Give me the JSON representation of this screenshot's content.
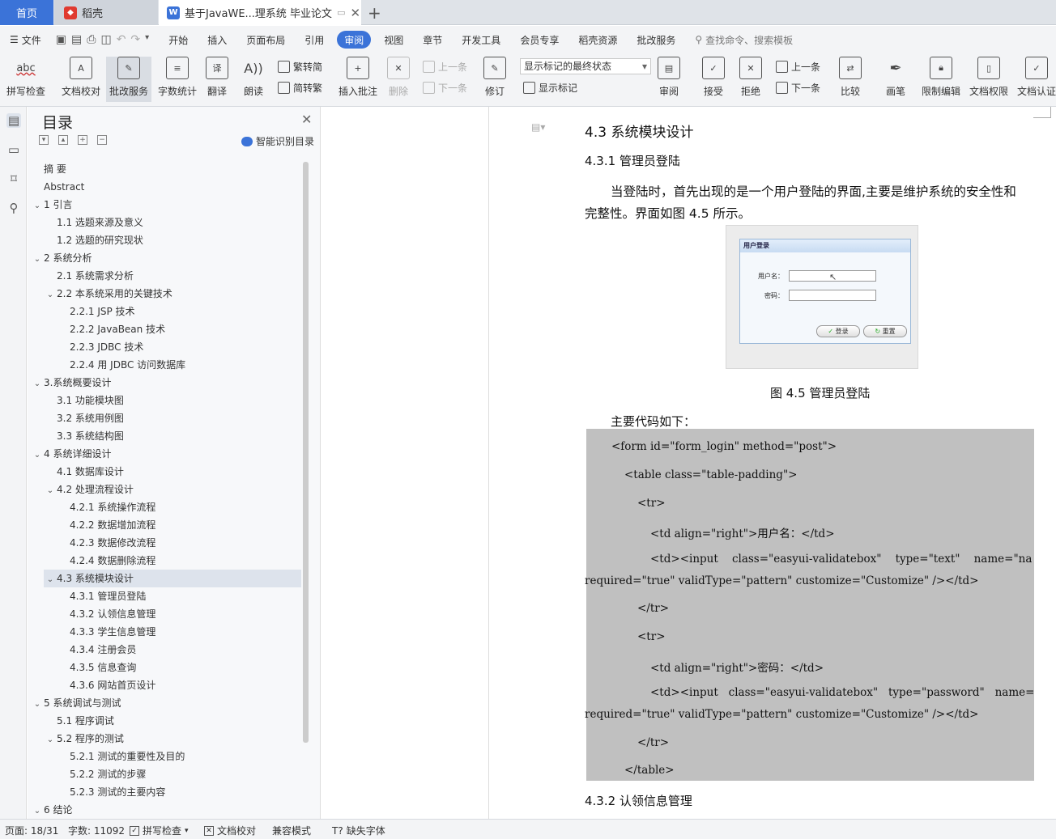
{
  "tabs": {
    "home": "首页",
    "daoke": "稻壳",
    "doc": "基于JavaWE...理系统 毕业论文"
  },
  "menu": {
    "file": "文件",
    "items": [
      "开始",
      "插入",
      "页面布局",
      "引用",
      "审阅",
      "视图",
      "章节",
      "开发工具",
      "会员专享",
      "稻壳资源",
      "批改服务"
    ],
    "search": "查找命令、搜索模板"
  },
  "ribbon": {
    "abc": "abc",
    "spell": "拼写检查",
    "proofread": "文档校对",
    "grading": "批改服务",
    "wordcount": "字数统计",
    "translate": "翻译",
    "read": "朗读",
    "trad": "繁转简",
    "simp": "简转繁",
    "insert_comment": "插入批注",
    "delete": "删除",
    "prev": "上一条",
    "next": "下一条",
    "revise": "修订",
    "mark_state": "显示标记的最终状态",
    "show_marks": "显示标记",
    "review": "审阅",
    "accept": "接受",
    "reject": "拒绝",
    "prev2": "上一条",
    "next2": "下一条",
    "compare": "比较",
    "pen": "画笔",
    "restrict": "限制编辑",
    "rights": "文档权限",
    "certify": "文档认证"
  },
  "toc": {
    "title": "目录",
    "smart": "智能识别目录",
    "items": [
      {
        "t": "摘  要",
        "lvl": 0
      },
      {
        "t": "Abstract",
        "lvl": 0
      },
      {
        "t": "1  引言",
        "lvl": 0,
        "c": true
      },
      {
        "t": "1.1  选题来源及意义",
        "lvl": 1
      },
      {
        "t": "1.2  选题的研究现状",
        "lvl": 1
      },
      {
        "t": "2  系统分析",
        "lvl": 0,
        "c": true
      },
      {
        "t": "2.1  系统需求分析",
        "lvl": 1
      },
      {
        "t": "2.2  本系统采用的关键技术",
        "lvl": 1,
        "c": true
      },
      {
        "t": "2.2.1    JSP 技术",
        "lvl": 2
      },
      {
        "t": "2.2.2    JavaBean 技术",
        "lvl": 2
      },
      {
        "t": "2.2.3    JDBC 技术",
        "lvl": 2
      },
      {
        "t": "2.2.4    用 JDBC 访问数据库",
        "lvl": 2
      },
      {
        "t": "3.系统概要设计",
        "lvl": 0,
        "c": true
      },
      {
        "t": "3.1 功能模块图",
        "lvl": 1
      },
      {
        "t": "3.2 系统用例图",
        "lvl": 1
      },
      {
        "t": "3.3 系统结构图",
        "lvl": 1
      },
      {
        "t": "4  系统详细设计",
        "lvl": 0,
        "c": true
      },
      {
        "t": "4.1 数据库设计",
        "lvl": 1
      },
      {
        "t": "4.2  处理流程设计",
        "lvl": 1,
        "c": true
      },
      {
        "t": "4.2.1    系统操作流程",
        "lvl": 2
      },
      {
        "t": "4.2.2    数据增加流程",
        "lvl": 2
      },
      {
        "t": "4.2.3    数据修改流程",
        "lvl": 2
      },
      {
        "t": "4.2.4    数据删除流程",
        "lvl": 2
      },
      {
        "t": "4.3  系统模块设计",
        "lvl": 1,
        "c": true,
        "hl": true
      },
      {
        "t": "4.3.1    管理员登陆",
        "lvl": 2
      },
      {
        "t": "4.3.2    认领信息管理",
        "lvl": 2
      },
      {
        "t": "4.3.3    学生信息管理",
        "lvl": 2
      },
      {
        "t": "4.3.4    注册会员",
        "lvl": 2
      },
      {
        "t": "4.3.5    信息查询",
        "lvl": 2
      },
      {
        "t": "4.3.6    网站首页设计",
        "lvl": 2
      },
      {
        "t": "5  系统调试与测试",
        "lvl": 0,
        "c": true
      },
      {
        "t": "5.1  程序调试",
        "lvl": 1
      },
      {
        "t": "5.2  程序的测试",
        "lvl": 1,
        "c": true
      },
      {
        "t": "5.2.1    测试的重要性及目的",
        "lvl": 2
      },
      {
        "t": "5.2.2    测试的步骤",
        "lvl": 2
      },
      {
        "t": "5.2.3    测试的主要内容",
        "lvl": 2
      },
      {
        "t": "6  结论",
        "lvl": 0,
        "c": true
      }
    ]
  },
  "doc": {
    "h1": "4.3  系统模块设计",
    "h2": "4.3.1    管理员登陆",
    "p1a": "当登陆时，首先出现的是一个用户登陆的界面,主要是维护系统的安全性和",
    "p1b": "完整性。界面如图 4.5 所示。",
    "fig": {
      "title": "用户登录",
      "user_label": "用户名：",
      "pwd_label": "密码：",
      "login": "登录",
      "reset": "重置"
    },
    "caption": "图 4.5  管理员登陆",
    "code_intro": "主要代码如下：",
    "code": [
      "<form id=\"form_login\" method=\"post\">",
      "<table class=\"table-padding\">",
      "<tr>",
      "<td align=\"right\">用户名：</td>",
      "<td><input    class=\"easyui-validatebox\"    type=\"text\"    name=\"name\"",
      "required=\"true\" validType=\"pattern\" customize=\"Customize\" /></td>",
      "</tr>",
      "<tr>",
      "<td align=\"right\">密码：</td>",
      "<td><input   class=\"easyui-validatebox\"   type=\"password\"   name=\"pwd\"",
      "required=\"true\" validType=\"pattern\" customize=\"Customize\" /></td>",
      "</tr>",
      "</table>"
    ],
    "h2b": "4.3.2    认领信息管理"
  },
  "status": {
    "page": "页面: 18/31",
    "words": "字数: 11092",
    "spell": "拼写检查",
    "proof": "文档校对",
    "compat": "兼容模式",
    "font": "缺失字体"
  }
}
